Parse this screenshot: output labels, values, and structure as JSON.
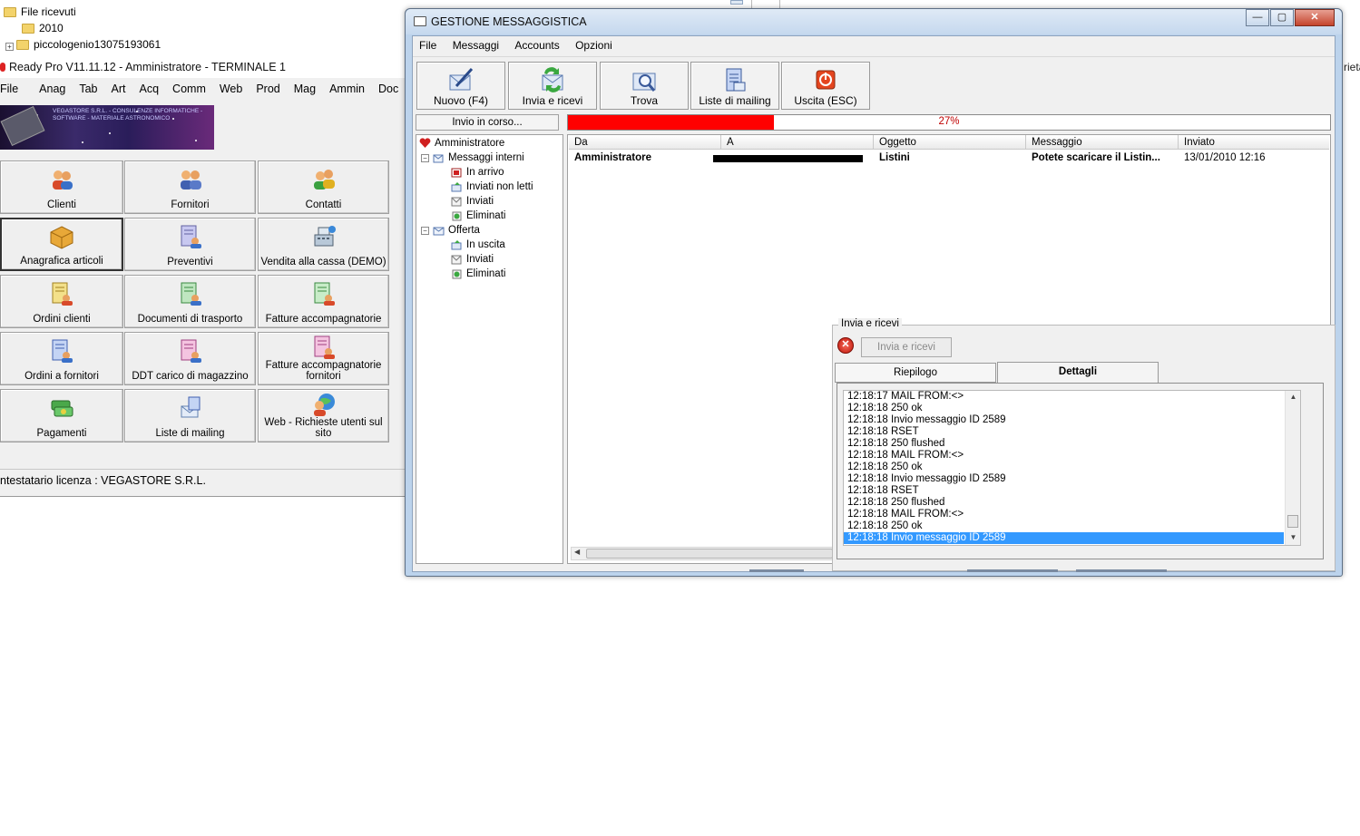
{
  "background": {
    "tree": [
      {
        "label": "File ricevuti"
      },
      {
        "label": "2010"
      },
      {
        "label": "piccologenio13075193061"
      }
    ],
    "right_fragment": "rieta"
  },
  "readypro": {
    "title": "Ready Pro V11.11.12 - Amministratore - TERMINALE 1",
    "menu": [
      "File",
      "Anag",
      "Tab",
      "Art",
      "Acq",
      "Comm",
      "Web",
      "Prod",
      "Mag",
      "Ammin",
      "Doc"
    ],
    "banner_text": "VEGASTORE S.R.L. - CONSULENZE INFORMATICHE - SOFTWARE - MATERIALE ASTRONOMICO",
    "buttons": [
      {
        "label": "Clienti",
        "icon": "clients-icon"
      },
      {
        "label": "Fornitori",
        "icon": "suppliers-icon"
      },
      {
        "label": "Contatti",
        "icon": "contacts-icon"
      },
      {
        "label": "Anagrafica articoli",
        "icon": "box-icon"
      },
      {
        "label": "Preventivi",
        "icon": "quote-icon"
      },
      {
        "label": "Vendita alla cassa (DEMO)",
        "icon": "cash-register-icon"
      },
      {
        "label": "Ordini clienti",
        "icon": "customer-orders-icon"
      },
      {
        "label": "Documenti di trasporto",
        "icon": "transport-docs-icon"
      },
      {
        "label": "Fatture accompagnatorie",
        "icon": "invoice-icon"
      },
      {
        "label": "Ordini a fornitori",
        "icon": "supplier-orders-icon"
      },
      {
        "label": "DDT carico di magazzino",
        "icon": "warehouse-ddt-icon"
      },
      {
        "label": "Fatture accompagnatorie fornitori",
        "icon": "supplier-invoice-icon"
      },
      {
        "label": "Pagamenti",
        "icon": "payments-icon"
      },
      {
        "label": "Liste di mailing",
        "icon": "mailing-list-icon"
      },
      {
        "label": "Web - Richieste utenti sul sito",
        "icon": "web-requests-icon"
      }
    ],
    "status": "ntestatario licenza : VEGASTORE S.R.L."
  },
  "gm": {
    "title": "GESTIONE MESSAGGISTICA",
    "window_buttons": {
      "min": "—",
      "max": "▢",
      "close": "✕"
    },
    "menu": [
      "File",
      "Messaggi",
      "Accounts",
      "Opzioni"
    ],
    "toolbar": [
      {
        "label": "Nuovo (F4)",
        "icon": "new-message-icon"
      },
      {
        "label": "Invia e ricevi",
        "icon": "send-receive-icon"
      },
      {
        "label": "Trova",
        "icon": "find-icon"
      },
      {
        "label": "Liste di mailing",
        "icon": "mailing-list-icon"
      },
      {
        "label": "Uscita (ESC)",
        "icon": "exit-icon"
      }
    ],
    "invio_label": "Invio in corso...",
    "progress": {
      "value": 27,
      "text": "27%",
      "fill_color": "#ff0000"
    },
    "tree": {
      "root": "Amministratore",
      "folders": [
        {
          "label": "Messaggi interni",
          "children": [
            "In arrivo",
            "Inviati non letti",
            "Inviati",
            "Eliminati"
          ]
        },
        {
          "label": "Offerta",
          "children": [
            "In uscita",
            "Inviati",
            "Eliminati"
          ]
        }
      ]
    },
    "columns": [
      "Da",
      "A",
      "Oggetto",
      "Messaggio",
      "Inviato"
    ],
    "rows": [
      {
        "da": "Amministratore",
        "a": "",
        "oggetto": "Listini",
        "messaggio": "Potete scaricare il Listin...",
        "inviato": "13/01/2010 12:16"
      }
    ],
    "send_panel": {
      "title": "Invia e ricevi",
      "send_button": "Invia e ricevi",
      "tabs": [
        "Riepilogo",
        "Dettagli"
      ],
      "active_tab": "Dettagli",
      "log": [
        "12:18:17 MAIL FROM:<>",
        "12:18:18 250 ok",
        "12:18:18 Invio messaggio ID 2589",
        "12:18:18 RSET",
        "12:18:18 250 flushed",
        "12:18:18 MAIL FROM:<>",
        "12:18:18 250 ok",
        "12:18:18 Invio messaggio ID 2589",
        "12:18:18 RSET",
        "12:18:18 250 flushed",
        "12:18:18 MAIL FROM:<>",
        "12:18:18 250 ok",
        "12:18:18 Invio messaggio ID 2589"
      ],
      "selected_log_index": 12
    }
  }
}
